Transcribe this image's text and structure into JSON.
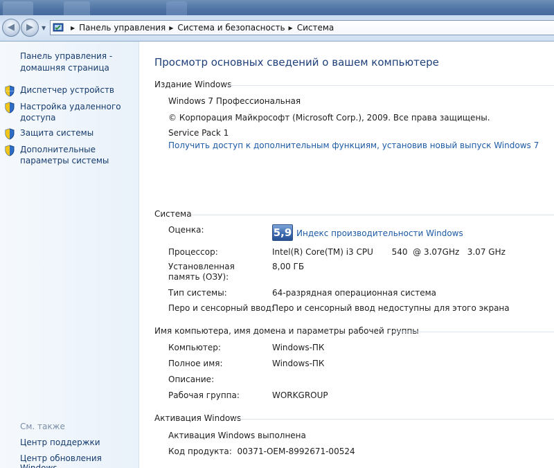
{
  "window": {
    "colors": {
      "glass": "#4d72a3",
      "link": "#1c5aa6",
      "nav_link": "#163b6e",
      "title": "#1e3f7a"
    }
  },
  "navigation": {
    "back_icon": "back-arrow-icon",
    "forward_icon": "forward-arrow-icon",
    "breadcrumbs": [
      "Панель управления",
      "Система и безопасность",
      "Система"
    ]
  },
  "left_pane": {
    "home_link": "Панель управления - домашняя страница",
    "tasks": [
      {
        "label": "Диспетчер устройств",
        "icon": "uac-shield-icon"
      },
      {
        "label": "Настройка удаленного доступа",
        "icon": "uac-shield-icon"
      },
      {
        "label": "Защита системы",
        "icon": "uac-shield-icon"
      },
      {
        "label": "Дополнительные параметры системы",
        "icon": "uac-shield-icon"
      }
    ],
    "see_also_title": "См. также",
    "see_also": [
      "Центр поддержки",
      "Центр обновления Windows"
    ]
  },
  "main": {
    "title": "Просмотр основных сведений о вашем компьютере",
    "edition": {
      "header": "Издание Windows",
      "name": "Windows 7 Профессиональная",
      "copyright": "© Корпорация Майкрософт (Microsoft Corp.), 2009. Все права защищены.",
      "service_pack": "Service Pack 1",
      "upgrade_link": "Получить доступ к дополнительным функциям, установив новый выпуск Windows 7"
    },
    "system": {
      "header": "Система",
      "rating_label": "Оценка:",
      "rating_value": "5,9",
      "rating_link": "Индекс производительности Windows",
      "processor_label": "Процессор:",
      "processor_value": "Intel(R) Core(TM) i3 CPU       540  @ 3.07GHz   3.07 GHz",
      "memory_label": "Установленная память (ОЗУ):",
      "memory_value": "8,00 ГБ",
      "type_label": "Тип системы:",
      "type_value": "64-разрядная операционная система",
      "pen_label": "Перо и сенсорный ввод:",
      "pen_value": "Перо и сенсорный ввод недоступны для этого экрана"
    },
    "computer": {
      "header": "Имя компьютера, имя домена и параметры рабочей группы",
      "computer_label": "Компьютер:",
      "computer_value": "Windows-ПК",
      "fullname_label": "Полное имя:",
      "fullname_value": "Windows-ПК",
      "description_label": "Описание:",
      "description_value": "",
      "workgroup_label": "Рабочая группа:",
      "workgroup_value": "WORKGROUP"
    },
    "activation": {
      "header": "Активация Windows",
      "status": "Активация Windows выполнена",
      "product_key": "Код продукта:  00371-OEM-8992671-00524"
    }
  }
}
